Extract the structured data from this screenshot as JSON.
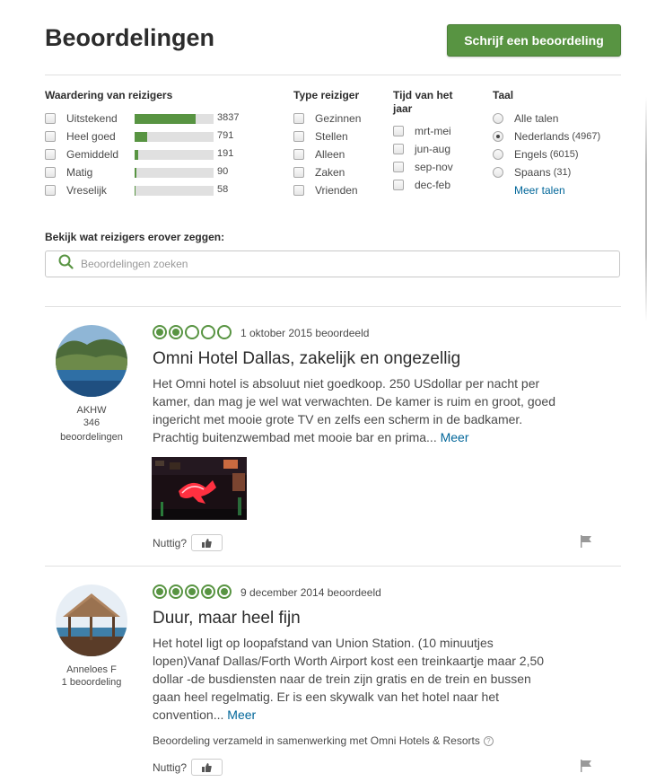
{
  "header": {
    "title": "Beoordelingen",
    "write_button": "Schrijf een beoordeling"
  },
  "filters": {
    "rating": {
      "heading": "Waardering van reizigers",
      "items": [
        {
          "label": "Uitstekend",
          "count": "3837",
          "fraction": 0.77
        },
        {
          "label": "Heel goed",
          "count": "791",
          "fraction": 0.16
        },
        {
          "label": "Gemiddeld",
          "count": "191",
          "fraction": 0.04
        },
        {
          "label": "Matig",
          "count": "90",
          "fraction": 0.02
        },
        {
          "label": "Vreselijk",
          "count": "58",
          "fraction": 0.015
        }
      ]
    },
    "traveler_type": {
      "heading": "Type reiziger",
      "items": [
        "Gezinnen",
        "Stellen",
        "Alleen",
        "Zaken",
        "Vrienden"
      ]
    },
    "time_of_year": {
      "heading": "Tijd van het jaar",
      "items": [
        "mrt-mei",
        "jun-aug",
        "sep-nov",
        "dec-feb"
      ]
    },
    "language": {
      "heading": "Taal",
      "items": [
        {
          "label": "Alle talen",
          "count": "",
          "selected": false
        },
        {
          "label": "Nederlands",
          "count": "(4967)",
          "selected": true
        },
        {
          "label": "Engels",
          "count": "(6015)",
          "selected": false
        },
        {
          "label": "Spaans",
          "count": "(31)",
          "selected": false
        }
      ],
      "more_link": "Meer talen"
    }
  },
  "search": {
    "heading": "Bekijk wat reizigers erover zeggen:",
    "placeholder": "Beoordelingen zoeken"
  },
  "reviews": [
    {
      "username": "AKHW",
      "review_count": "346",
      "review_count_label": "beoordelingen",
      "rating": 2,
      "date": "1 oktober 2015 beoordeeld",
      "title": "Omni Hotel Dallas, zakelijk en ongezellig",
      "text": "Het Omni hotel is absoluut niet goedkoop. 250 USdollar per nacht per kamer, dan mag je wel wat verwachten. De kamer is ruim en groot, goed ingericht met mooie grote TV en zelfs een scherm in de badkamer. Prachtig buitenzwembad met mooie bar en prima...",
      "more": "Meer",
      "helpful": "Nuttig?"
    },
    {
      "username": "Anneloes F",
      "review_count": "1 beoordeling",
      "rating": 5,
      "date": "9 december 2014 beoordeeld",
      "title": "Duur, maar heel fijn",
      "text": "Het hotel ligt op loopafstand van Union Station. (10 minuutjes lopen)Vanaf Dallas/Forth Worth Airport kost een treinkaartje maar 2,50 dollar -de busdiensten naar de trein zijn gratis en de trein en bussen gaan heel regelmatig. Er is een skywalk van het hotel naar het convention...",
      "more": "Meer",
      "collected": "Beoordeling verzameld in samenwerking met Omni Hotels & Resorts",
      "helpful": "Nuttig?"
    }
  ],
  "colors": {
    "accent": "#589442",
    "link": "#006699"
  }
}
